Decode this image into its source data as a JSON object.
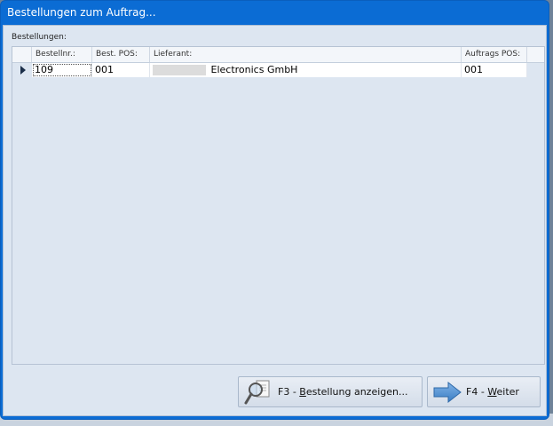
{
  "window": {
    "title": "Bestellungen zum Auftrag..."
  },
  "group_label": "Bestellungen:",
  "table": {
    "columns": [
      "Bestellnr.:",
      "Best. POS:",
      "Lieferant:",
      "Auftrags POS:"
    ],
    "rows": [
      {
        "bestellnr": "109",
        "best_pos": "001",
        "lieferant": "Electronics GmbH",
        "auftrags_pos": "001"
      }
    ]
  },
  "buttons": {
    "show_order": {
      "prefix": "F3 - ",
      "accel": "B",
      "rest": "estellung anzeigen..."
    },
    "next": {
      "prefix": "F4 - ",
      "accel": "W",
      "rest": "eiter"
    }
  },
  "colors": {
    "titlebar": "#0b6cd4",
    "client": "#dde6f1",
    "arrow": "#4f8fd0"
  },
  "icons": {
    "show_order": "magnifier-document-icon",
    "next": "right-arrow-icon"
  }
}
